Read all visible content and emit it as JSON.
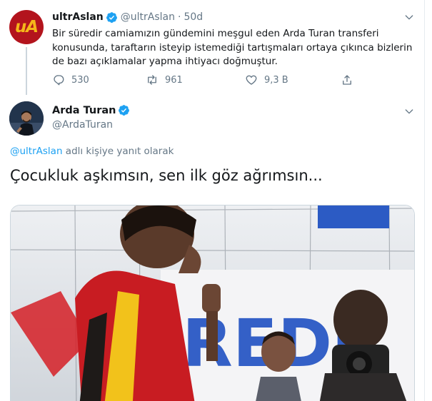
{
  "parent_tweet": {
    "display_name": "ultrAslan",
    "handle": "@ultrAslan",
    "separator": "·",
    "time": "50d",
    "avatar_text": "uA",
    "text": "Bir süredir camiamızın gündemini meşgul eden Arda Turan transferi konusunda, taraftarın isteyip istemediği tartışmaları ortaya çıkınca bizlerin de bazı açıklamalar yapma ihtiyacı doğmuştur.",
    "replies": "530",
    "retweets": "961",
    "likes": "9,3 B"
  },
  "main_tweet": {
    "display_name": "Arda Turan",
    "handle": "@ArdaTuran",
    "reply_mention": "@ultrAslan",
    "reply_suffix": "adlı kişiye yanıt olarak",
    "text": "Çocukluk aşkımsın, sen ilk göz ağrımsın...",
    "media_sign_text": "REDi"
  },
  "colors": {
    "accent": "#1da1f2",
    "secondary_text": "#657786",
    "avatar_ua_bg": "#b3141d",
    "avatar_ua_fg": "#f5b71a"
  },
  "icons": {
    "verified": "verified-badge-icon",
    "chevron": "chevron-down-icon",
    "reply": "reply-icon",
    "retweet": "retweet-icon",
    "like": "heart-icon",
    "share": "share-icon"
  }
}
